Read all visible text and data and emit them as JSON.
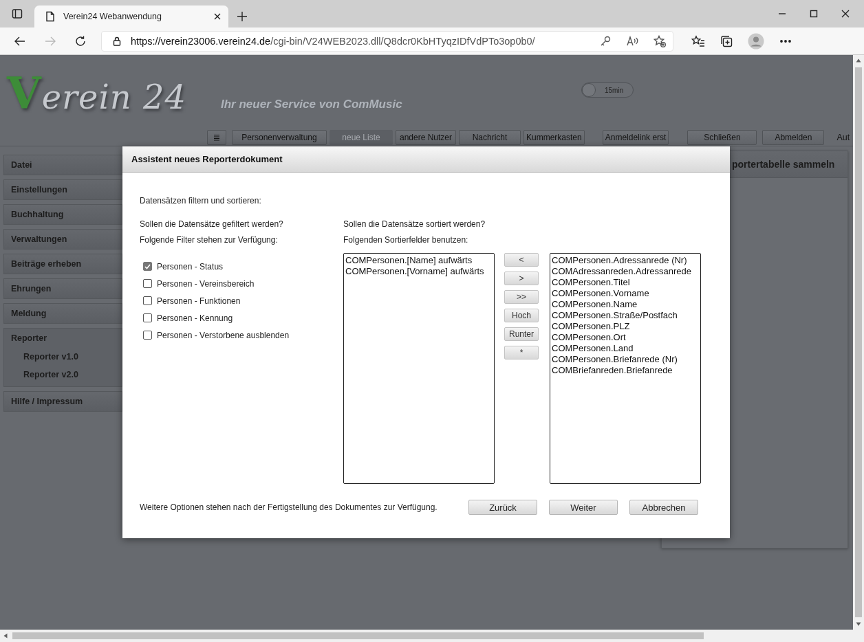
{
  "browser": {
    "tab_title": "Verein24 Webanwendung",
    "url_host": "https://verein23006.verein24.de",
    "url_path": "/cgi-bin/V24WEB2023.dll/Q8dcr0KbHTyqzIDfVdPTo3op0b0/",
    "forward_disabled": true
  },
  "header": {
    "logo": "Verein 24",
    "tagline": "Ihr neuer Service von ComMusic",
    "timer": "15min",
    "timer_on": false
  },
  "toolbar": {
    "buttons": [
      {
        "label": "Personenverwaltung",
        "disabled": false
      },
      {
        "label": "neue Liste",
        "disabled": true
      },
      {
        "label": "andere Nutzer",
        "disabled": false
      },
      {
        "label": "Nachricht",
        "disabled": false
      },
      {
        "label": "Kummerkasten",
        "disabled": false
      },
      {
        "label": "Anmeldelink erst",
        "disabled": false
      },
      {
        "label": "Schließen",
        "disabled": false
      },
      {
        "label": "Abmelden",
        "disabled": false
      }
    ],
    "trailing": "Aut"
  },
  "sidebar": {
    "items": [
      {
        "label": "Datei"
      },
      {
        "label": "Einstellungen"
      },
      {
        "label": "Buchhaltung"
      },
      {
        "label": "Verwaltungen"
      },
      {
        "label": "Beiträge erheben"
      },
      {
        "label": "Ehrungen"
      },
      {
        "label": "Meldung"
      },
      {
        "label": "Reporter",
        "children": [
          {
            "label": "Reporter v1.0"
          },
          {
            "label": "Reporter v2.0"
          }
        ]
      },
      {
        "label": "Hilfe / Impressum"
      }
    ]
  },
  "panel": {
    "title": "portertabelle sammeln"
  },
  "dialog": {
    "title": "Assistent neues Reporterdokument",
    "intro": "Datensätzen filtern und sortieren:",
    "filter_question": "Sollen die Datensätze gefiltert werden?",
    "filter_hint": "Folgende Filter stehen zur Verfügung:",
    "filters": [
      {
        "label": "Personen - Status",
        "checked": true
      },
      {
        "label": "Personen - Vereinsbereich",
        "checked": false
      },
      {
        "label": "Personen - Funktionen",
        "checked": false
      },
      {
        "label": "Personen - Kennung",
        "checked": false
      },
      {
        "label": "Personen - Verstorbene ausblenden",
        "checked": false
      }
    ],
    "sort_question": "Sollen die Datensätze sortiert werden?",
    "sort_hint": "Folgenden Sortierfelder benutzen:",
    "sort_selected": [
      "COMPersonen.[Name] aufwärts",
      "COMPersonen.[Vorname] aufwärts"
    ],
    "move_buttons": [
      "<",
      ">",
      ">>",
      "Hoch",
      "Runter",
      "*"
    ],
    "sort_available": [
      "COMPersonen.Adressanrede (Nr)",
      "COMAdressanreden.Adressanrede",
      "COMPersonen.Titel",
      "COMPersonen.Vorname",
      "COMPersonen.Name",
      "COMPersonen.Straße/Postfach",
      "COMPersonen.PLZ",
      "COMPersonen.Ort",
      "COMPersonen.Land",
      "COMPersonen.Briefanrede (Nr)",
      "COMBriefanreden.Briefanrede"
    ],
    "footer_note": "Weitere Optionen stehen nach der Fertigstellung des Dokumentes zur Verfügung.",
    "buttons": [
      "Zurück",
      "Weiter",
      "Abbrechen"
    ]
  }
}
